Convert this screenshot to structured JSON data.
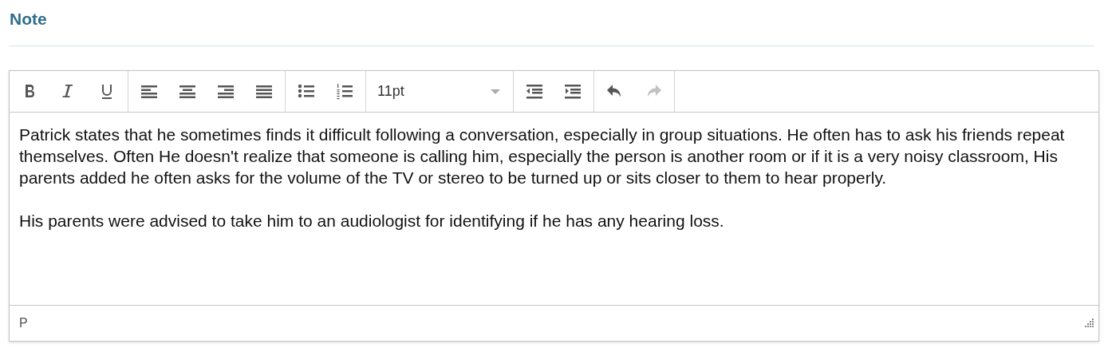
{
  "heading": "Note",
  "toolbar": [
    [
      {
        "kind": "bold",
        "disabled": false
      },
      {
        "kind": "italic",
        "disabled": false
      },
      {
        "kind": "underline",
        "disabled": false
      }
    ],
    [
      {
        "kind": "align-left",
        "disabled": false
      },
      {
        "kind": "align-center",
        "disabled": false
      },
      {
        "kind": "align-right",
        "disabled": false
      },
      {
        "kind": "justify",
        "disabled": false
      }
    ],
    [
      {
        "kind": "bullet-list",
        "disabled": false
      },
      {
        "kind": "numbered-list",
        "disabled": false
      }
    ],
    [
      {
        "kind": "font-size",
        "value": "11pt"
      }
    ],
    [
      {
        "kind": "outdent",
        "disabled": false
      },
      {
        "kind": "indent",
        "disabled": false
      }
    ],
    [
      {
        "kind": "undo",
        "disabled": false
      },
      {
        "kind": "redo",
        "disabled": true
      }
    ]
  ],
  "paragraphs": [
    "Patrick states that he sometimes finds it difficult following a conversation, especially in group situations. He often has to ask his friends repeat themselves. Often He doesn't realize that someone is calling him, especially the person is another room or if it is a very noisy classroom, His parents added he often asks for the volume of the TV or stereo to be turned up or sits closer to them to hear properly.",
    "His parents were advised to take him to an audiologist for identifying if he has any hearing loss."
  ],
  "status_path": "P"
}
